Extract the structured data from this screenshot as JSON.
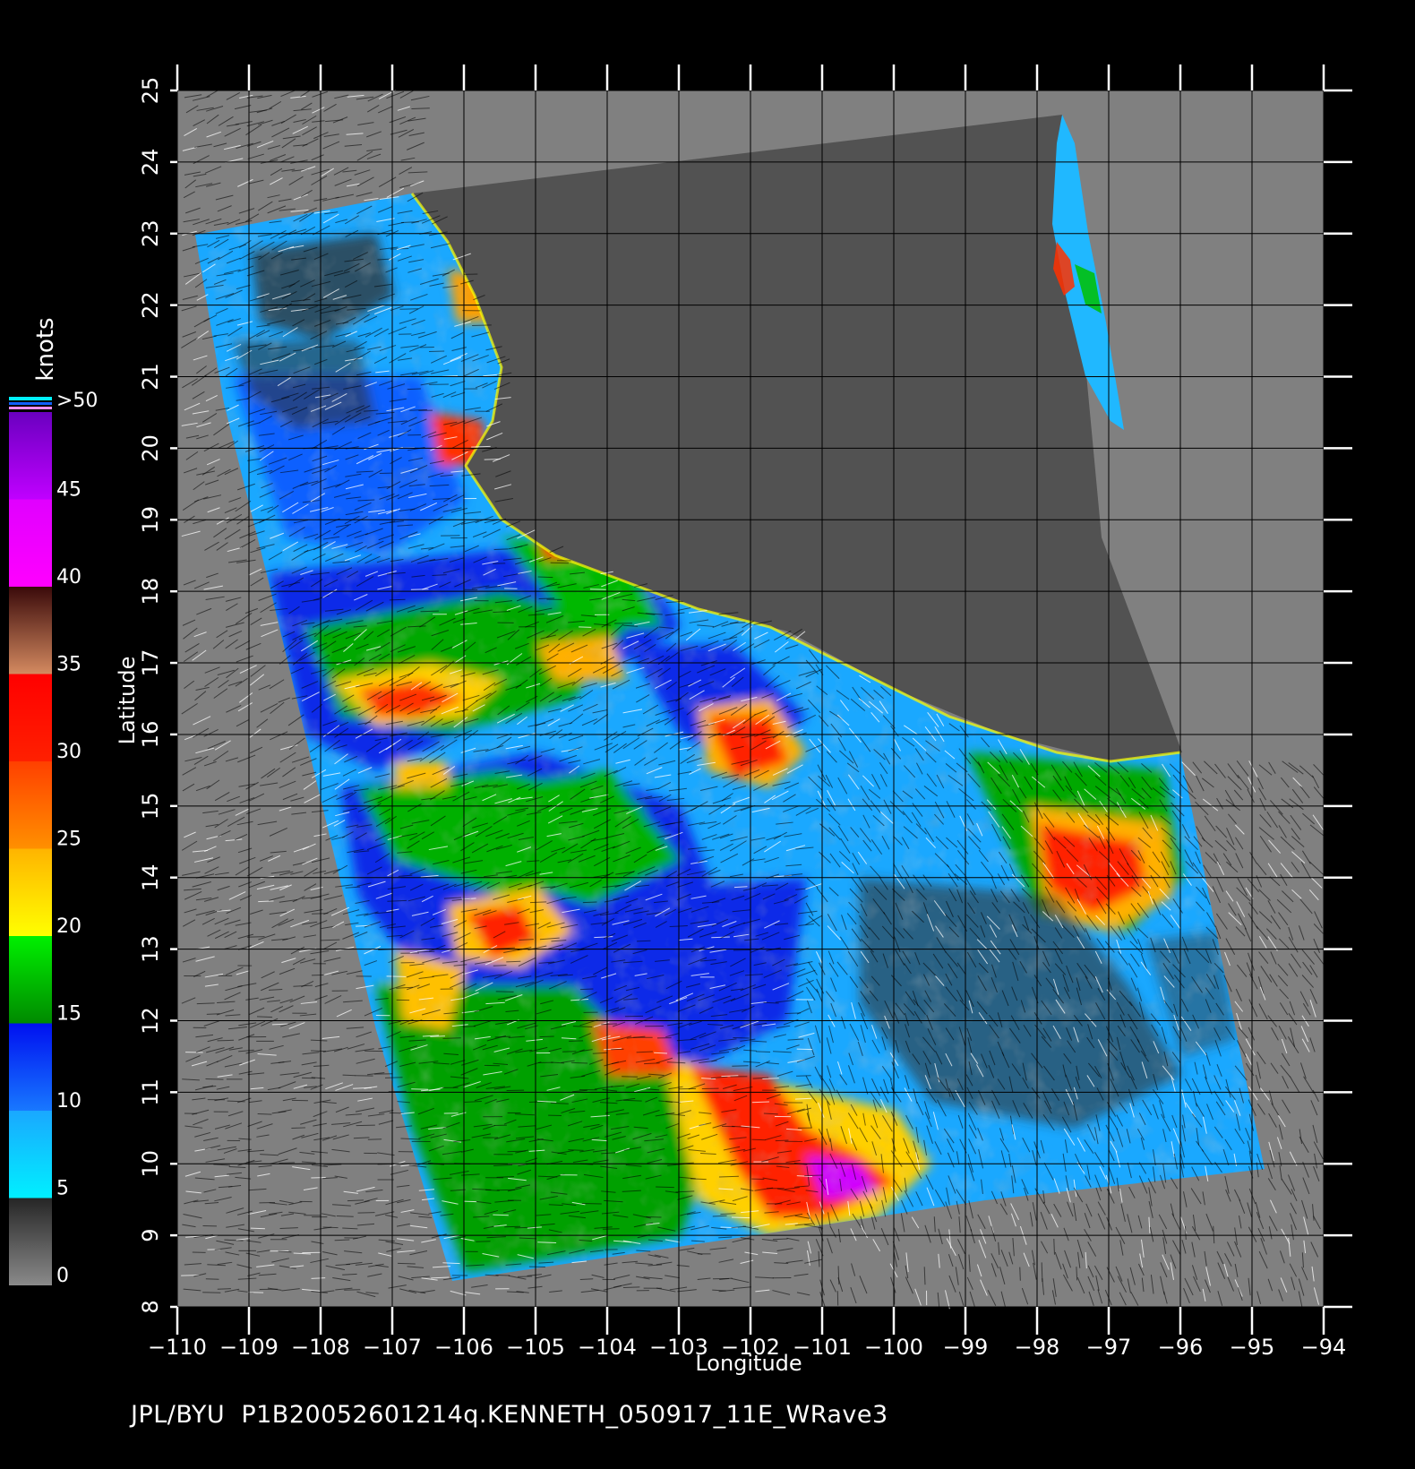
{
  "map": {
    "x_axis_label": "Longitude",
    "y_axis_label": "Latitude",
    "lon_ticks": [
      "−110",
      "−109",
      "−108",
      "−107",
      "−106",
      "−105",
      "−104",
      "−103",
      "−102",
      "−101",
      "−100",
      "−99",
      "−98",
      "−97",
      "−96",
      "−95",
      "−94"
    ],
    "lat_ticks": [
      "8",
      "9",
      "10",
      "11",
      "12",
      "13",
      "14",
      "15",
      "16",
      "17",
      "18",
      "19",
      "20",
      "21",
      "22",
      "23",
      "24",
      "25"
    ],
    "lon_range": [
      -110,
      -94
    ],
    "lat_range": [
      8,
      25
    ]
  },
  "colorbar": {
    "unit_label": "knots",
    "labels": [
      "0",
      "5",
      "10",
      "15",
      "20",
      "25",
      "30",
      "35",
      "40",
      "45",
      ">50"
    ],
    "bins": [
      {
        "from": 0,
        "to": 5,
        "colors": [
          "#8a8a8a",
          "#262626"
        ]
      },
      {
        "from": 5,
        "to": 10,
        "colors": [
          "#00f0ff",
          "#1aa8ff"
        ]
      },
      {
        "from": 10,
        "to": 15,
        "colors": [
          "#1878ff",
          "#0010f0"
        ]
      },
      {
        "from": 15,
        "to": 20,
        "colors": [
          "#008a00",
          "#00f000"
        ]
      },
      {
        "from": 20,
        "to": 25,
        "colors": [
          "#ffff00",
          "#ffb400"
        ]
      },
      {
        "from": 25,
        "to": 30,
        "colors": [
          "#ff9000",
          "#ff4000"
        ]
      },
      {
        "from": 30,
        "to": 35,
        "colors": [
          "#ff2000",
          "#ff0000"
        ]
      },
      {
        "from": 35,
        "to": 40,
        "colors": [
          "#d48a60",
          "#3a0a0a"
        ]
      },
      {
        "from": 40,
        "to": 45,
        "colors": [
          "#ff00ff",
          "#e000ff"
        ]
      },
      {
        "from": 45,
        "to": 50,
        "colors": [
          "#c000ff",
          "#6a00c0"
        ]
      }
    ]
  },
  "footer": {
    "text": "JPL/BYU  P1B20052601214q.KENNETH_050917_11E_WRave3"
  },
  "colors": {
    "background": "#000000",
    "no_data": "#808080",
    "land": "#525252",
    "grid": "#000000"
  }
}
